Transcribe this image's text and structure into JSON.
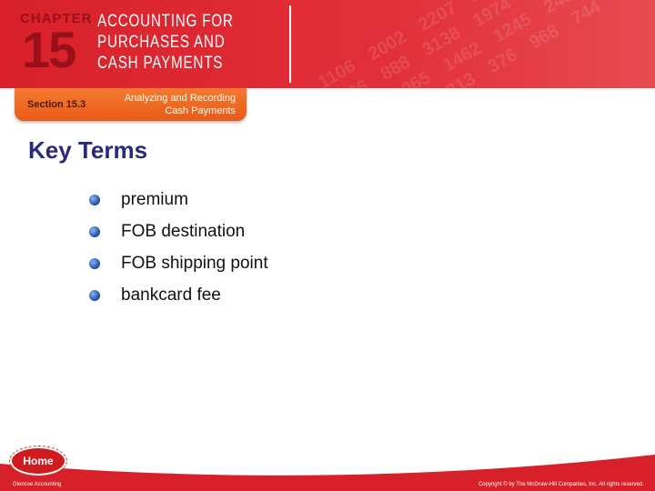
{
  "header": {
    "chapter_label": "CHAPTER",
    "chapter_number": "15",
    "chapter_title": [
      "ACCOUNTING FOR",
      "PURCHASES AND",
      "CASH PAYMENTS"
    ],
    "background_numbers": "972 1106 2002 2207 1650 2313 700 845 1236 888 3138 1974 140 1170 287 2430 1065 1462 1245 2481 1325 385 758 2887 813 376 968 744 877"
  },
  "section": {
    "label": "Section 15.3",
    "title_line1": "Analyzing and Recording",
    "title_line2": "Cash Payments"
  },
  "main": {
    "heading": "Key Terms",
    "terms": [
      "premium",
      "FOB destination",
      "FOB shipping point",
      "bankcard fee"
    ]
  },
  "footer": {
    "home_label": "Home",
    "left_text": "Glencoe Accounting",
    "right_text": "Copyright © by The McGraw-Hill Companies, Inc. All rights reserved."
  },
  "colors": {
    "banner": "#d8202a",
    "section_tab": "#f06a24",
    "heading": "#2a2a7a"
  }
}
